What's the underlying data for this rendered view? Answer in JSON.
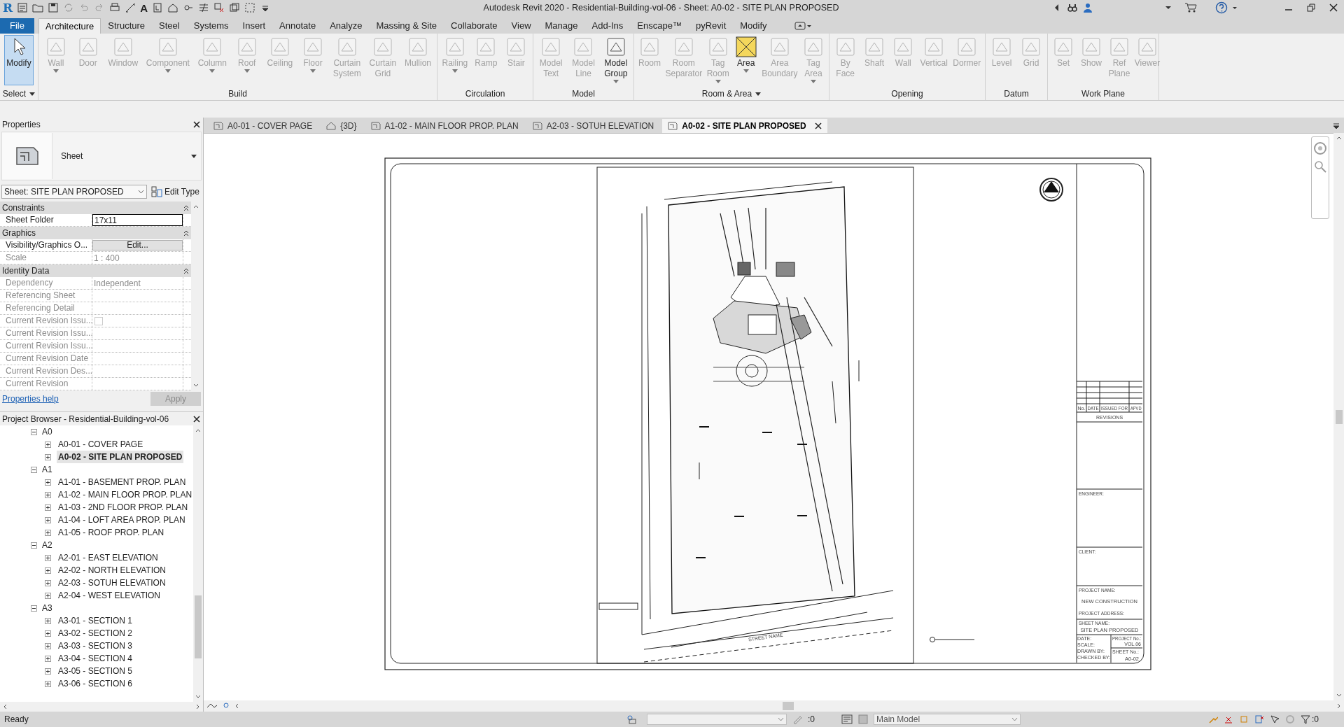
{
  "title_bar": {
    "logo": "R",
    "text_tool": "A",
    "title": "Autodesk Revit 2020 - Residential-Building-vol-06 - Sheet: A0-02 - SITE PLAN PROPOSED"
  },
  "ribbon_tabs": [
    {
      "label": "File",
      "kind": "file",
      "selected": false
    },
    {
      "label": "Architecture",
      "kind": "tab",
      "selected": true
    },
    {
      "label": "Structure",
      "kind": "tab",
      "selected": false
    },
    {
      "label": "Steel",
      "kind": "tab",
      "selected": false
    },
    {
      "label": "Systems",
      "kind": "tab",
      "selected": false
    },
    {
      "label": "Insert",
      "kind": "tab",
      "selected": false
    },
    {
      "label": "Annotate",
      "kind": "tab",
      "selected": false
    },
    {
      "label": "Analyze",
      "kind": "tab",
      "selected": false
    },
    {
      "label": "Massing & Site",
      "kind": "tab",
      "selected": false
    },
    {
      "label": "Collaborate",
      "kind": "tab",
      "selected": false
    },
    {
      "label": "View",
      "kind": "tab",
      "selected": false
    },
    {
      "label": "Manage",
      "kind": "tab",
      "selected": false
    },
    {
      "label": "Add-Ins",
      "kind": "tab",
      "selected": false
    },
    {
      "label": "Enscape™",
      "kind": "tab",
      "selected": false
    },
    {
      "label": "pyRevit",
      "kind": "tab",
      "selected": false
    },
    {
      "label": "Modify",
      "kind": "tab",
      "selected": false
    }
  ],
  "ribbon_panels": [
    {
      "title": "Select",
      "menu": true,
      "tools": [
        {
          "label": "Modify",
          "kind": "pointer",
          "enabled": true,
          "selected": true,
          "dropdown": false
        }
      ]
    },
    {
      "title": "Build",
      "menu": false,
      "tools": [
        {
          "label": "Wall",
          "kind": "tool",
          "enabled": false,
          "selected": false,
          "dropdown": true
        },
        {
          "label": "Door",
          "kind": "tool",
          "enabled": false,
          "selected": false,
          "dropdown": false
        },
        {
          "label": "Window",
          "kind": "tool",
          "enabled": false,
          "selected": false,
          "dropdown": false
        },
        {
          "label": "Component",
          "kind": "tool",
          "enabled": false,
          "selected": false,
          "dropdown": true
        },
        {
          "label": "Column",
          "kind": "tool",
          "enabled": false,
          "selected": false,
          "dropdown": true
        },
        {
          "label": "Roof",
          "kind": "tool",
          "enabled": false,
          "selected": false,
          "dropdown": true
        },
        {
          "label": "Ceiling",
          "kind": "tool",
          "enabled": false,
          "selected": false,
          "dropdown": false
        },
        {
          "label": "Floor",
          "kind": "tool",
          "enabled": false,
          "selected": false,
          "dropdown": true
        },
        {
          "label": "Curtain System",
          "kind": "tool",
          "enabled": false,
          "selected": false,
          "dropdown": false
        },
        {
          "label": "Curtain Grid",
          "kind": "tool",
          "enabled": false,
          "selected": false,
          "dropdown": false
        },
        {
          "label": "Mullion",
          "kind": "tool",
          "enabled": false,
          "selected": false,
          "dropdown": false
        }
      ]
    },
    {
      "title": "Circulation",
      "menu": false,
      "tools": [
        {
          "label": "Railing",
          "kind": "tool",
          "enabled": false,
          "selected": false,
          "dropdown": true
        },
        {
          "label": "Ramp",
          "kind": "tool",
          "enabled": false,
          "selected": false,
          "dropdown": false
        },
        {
          "label": "Stair",
          "kind": "tool",
          "enabled": false,
          "selected": false,
          "dropdown": false
        }
      ]
    },
    {
      "title": "Model",
      "menu": false,
      "tools": [
        {
          "label": "Model Text",
          "kind": "tool",
          "enabled": false,
          "selected": false,
          "dropdown": false
        },
        {
          "label": "Model Line",
          "kind": "tool",
          "enabled": false,
          "selected": false,
          "dropdown": false
        },
        {
          "label": "Model Group",
          "kind": "tool",
          "enabled": true,
          "selected": false,
          "dropdown": true
        }
      ]
    },
    {
      "title": "Room & Area",
      "menu": true,
      "tools": [
        {
          "label": "Room",
          "kind": "tool",
          "enabled": false,
          "selected": false,
          "dropdown": false
        },
        {
          "label": "Room Separator",
          "kind": "tool",
          "enabled": false,
          "selected": false,
          "dropdown": false
        },
        {
          "label": "Tag Room",
          "kind": "tool",
          "enabled": false,
          "selected": false,
          "dropdown": true
        },
        {
          "label": "Area",
          "kind": "highlight",
          "enabled": true,
          "selected": false,
          "dropdown": true
        },
        {
          "label": "Area Boundary",
          "kind": "tool",
          "enabled": false,
          "selected": false,
          "dropdown": false
        },
        {
          "label": "Tag Area",
          "kind": "tool",
          "enabled": false,
          "selected": false,
          "dropdown": true
        }
      ]
    },
    {
      "title": "Opening",
      "menu": false,
      "tools": [
        {
          "label": "By Face",
          "kind": "tool",
          "enabled": false,
          "selected": false,
          "dropdown": false
        },
        {
          "label": "Shaft",
          "kind": "tool",
          "enabled": false,
          "selected": false,
          "dropdown": false
        },
        {
          "label": "Wall",
          "kind": "tool",
          "enabled": false,
          "selected": false,
          "dropdown": false
        },
        {
          "label": "Vertical",
          "kind": "tool",
          "enabled": false,
          "selected": false,
          "dropdown": false
        },
        {
          "label": "Dormer",
          "kind": "tool",
          "enabled": false,
          "selected": false,
          "dropdown": false
        }
      ]
    },
    {
      "title": "Datum",
      "menu": false,
      "tools": [
        {
          "label": "Level",
          "kind": "tool",
          "enabled": false,
          "selected": false,
          "dropdown": false
        },
        {
          "label": "Grid",
          "kind": "tool",
          "enabled": false,
          "selected": false,
          "dropdown": false
        }
      ]
    },
    {
      "title": "Work Plane",
      "menu": false,
      "tools": [
        {
          "label": "Set",
          "kind": "tool",
          "enabled": false,
          "selected": false,
          "dropdown": false
        },
        {
          "label": "Show",
          "kind": "tool",
          "enabled": false,
          "selected": false,
          "dropdown": false
        },
        {
          "label": "Ref Plane",
          "kind": "tool",
          "enabled": false,
          "selected": false,
          "dropdown": false
        },
        {
          "label": "Viewer",
          "kind": "tool",
          "enabled": false,
          "selected": false,
          "dropdown": false
        }
      ]
    }
  ],
  "properties": {
    "title": "Properties",
    "type_name": "Sheet",
    "instance_selector": "Sheet: SITE PLAN PROPOSED",
    "edit_type": "Edit Type",
    "groups": [
      {
        "title": "Constraints",
        "rows": [
          {
            "label": "Sheet Folder",
            "value": "17x11",
            "kind": "field",
            "readonly": false
          }
        ]
      },
      {
        "title": "Graphics",
        "rows": [
          {
            "label": "Visibility/Graphics O...",
            "value": "Edit...",
            "kind": "button",
            "readonly": false
          },
          {
            "label": "Scale",
            "value": "1 : 400",
            "kind": "text",
            "readonly": true
          }
        ]
      },
      {
        "title": "Identity Data",
        "rows": [
          {
            "label": "Dependency",
            "value": "Independent",
            "kind": "text",
            "readonly": true
          },
          {
            "label": "Referencing Sheet",
            "kind": "text",
            "readonly": true
          },
          {
            "label": "Referencing Detail",
            "kind": "text",
            "readonly": true
          },
          {
            "label": "Current Revision Issu...",
            "kind": "checkbox",
            "checked": false,
            "readonly": true
          },
          {
            "label": "Current Revision Issu...",
            "kind": "text",
            "readonly": true
          },
          {
            "label": "Current Revision Issu...",
            "kind": "text",
            "readonly": true
          },
          {
            "label": "Current Revision Date",
            "kind": "text",
            "readonly": true
          },
          {
            "label": "Current Revision Des...",
            "kind": "text",
            "readonly": true
          },
          {
            "label": "Current Revision",
            "kind": "text",
            "readonly": true
          }
        ]
      }
    ],
    "help_link": "Properties help",
    "apply": {
      "label": "Apply",
      "enabled": false
    }
  },
  "project_browser": {
    "title": "Project Browser - Residential-Building-vol-06",
    "tree": [
      {
        "label": "A0",
        "expanded": true,
        "children": [
          {
            "label": "A0-01 - COVER PAGE",
            "selected": false
          },
          {
            "label": "A0-02 - SITE PLAN PROPOSED",
            "selected": true
          }
        ]
      },
      {
        "label": "A1",
        "expanded": true,
        "children": [
          {
            "label": "A1-01 - BASEMENT PROP. PLAN",
            "selected": false
          },
          {
            "label": "A1-02 - MAIN FLOOR PROP. PLAN",
            "selected": false
          },
          {
            "label": "A1-03 - 2ND FLOOR PROP. PLAN",
            "selected": false
          },
          {
            "label": "A1-04 - LOFT AREA PROP. PLAN",
            "selected": false
          },
          {
            "label": "A1-05 - ROOF PROP. PLAN",
            "selected": false
          }
        ]
      },
      {
        "label": "A2",
        "expanded": true,
        "children": [
          {
            "label": "A2-01 - EAST ELEVATION",
            "selected": false
          },
          {
            "label": "A2-02 - NORTH ELEVATION",
            "selected": false
          },
          {
            "label": "A2-03 - SOTUH ELEVATION",
            "selected": false
          },
          {
            "label": "A2-04 - WEST ELEVATION",
            "selected": false
          }
        ]
      },
      {
        "label": "A3",
        "expanded": true,
        "children": [
          {
            "label": "A3-01 - SECTION 1",
            "selected": false
          },
          {
            "label": "A3-02 - SECTION 2",
            "selected": false
          },
          {
            "label": "A3-03 - SECTION 3",
            "selected": false
          },
          {
            "label": "A3-04 - SECTION 4",
            "selected": false
          },
          {
            "label": "A3-05 - SECTION 5",
            "selected": false
          },
          {
            "label": "A3-06 - SECTION 6",
            "selected": false
          }
        ]
      }
    ]
  },
  "view_tabs": [
    {
      "label": "A0-01 - COVER PAGE",
      "kind": "sheet",
      "selected": false
    },
    {
      "label": "{3D}",
      "kind": "model",
      "selected": false
    },
    {
      "label": "A1-02 - MAIN FLOOR PROP. PLAN",
      "kind": "sheet",
      "selected": false
    },
    {
      "label": "A2-03 - SOTUH ELEVATION",
      "kind": "sheet",
      "selected": false
    },
    {
      "label": "A0-02 - SITE PLAN PROPOSED",
      "kind": "sheet",
      "selected": true
    }
  ],
  "sheet": {
    "street_name": "STREET NAME",
    "title_block": {
      "revision_columns": [
        "No.",
        "DATE",
        "ISSUED FOR",
        "APVD"
      ],
      "revisions_label": "REVISIONS",
      "engineer_label": "ENGINEER:",
      "client_label": "CLIENT:",
      "project_name_label": "PROJECT NAME:",
      "project_name": "NEW CONSTRUCTION",
      "project_address_label": "PROJECT ADDRESS:",
      "sheet_name_label": "SHEET NAME:",
      "sheet_name": "SITE PLAN PROPOSED",
      "date_label": "DATE:",
      "scale_label": "SCALE:",
      "drawn_by_label": "DRAWN BY:",
      "checked_by_label": "CHECKED BY:",
      "project_no_label": "PROJECT No.:",
      "project_no": "VOL.06",
      "sheet_no_label": "SHEET No.:",
      "sheet_no": "A0-02"
    }
  },
  "status_bar": {
    "status": "Ready",
    "worksets_count": ":0",
    "design_option": "Main Model",
    "filter_count": ":0"
  }
}
